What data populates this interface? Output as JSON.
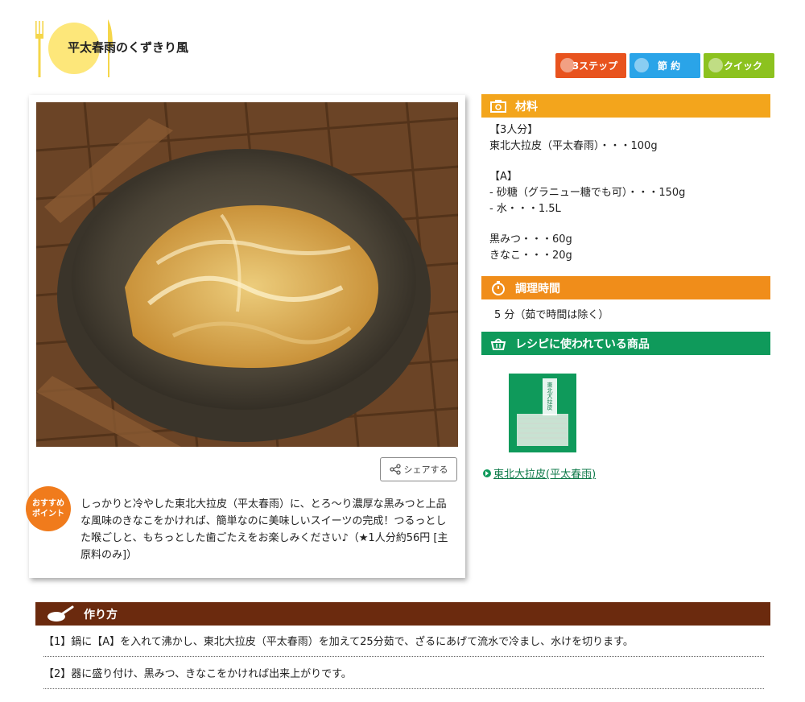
{
  "title": "平太春雨のくずきり風",
  "badges": {
    "step": "3ステップ",
    "save": "節 約",
    "quick": "クイック"
  },
  "share": {
    "label": "シェアする"
  },
  "point": {
    "badge_line1": "おすすめ",
    "badge_line2": "ポイント",
    "text": "しっかりと冷やした東北大拉皮（平太春雨）に、とろ〜り濃厚な黒みつと上品な風味のきなこをかければ、簡単なのに美味しいスイーツの完成！つるっとした喉ごしと、もちっとした歯ごたえをお楽しみください♪（★1人分約56円 [主原料のみ]）"
  },
  "ingredients": {
    "heading": "材料",
    "lines": [
      "【3人分】",
      "東北大拉皮（平太春雨）・・・100g",
      "",
      "【A】",
      "- 砂糖（グラニュー糖でも可）・・・150g",
      "- 水・・・1.5L",
      "",
      "黒みつ・・・60g",
      "きなこ・・・20g"
    ]
  },
  "cook_time": {
    "heading": "調理時間",
    "text": "5 分（茹で時間は除く）"
  },
  "products": {
    "heading": "レシピに使われている商品",
    "link": "東北大拉皮(平太春雨)",
    "package_text": "東北大拉皮"
  },
  "method": {
    "heading": "作り方",
    "steps": [
      "【1】鍋に【A】を入れて沸かし、東北大拉皮（平太春雨）を加えて25分茹で、ざるにあげて流水で冷まし、水けを切ります。",
      "【2】器に盛り付け、黒みつ、きなこをかければ出来上がりです。"
    ]
  },
  "colors": {
    "ingredients": "#f3a51c",
    "cook_time": "#f08d1a",
    "products": "#0f9a5b",
    "method": "#6b2a0e",
    "step_badge": "#e8531e",
    "save_badge": "#2aa4e8",
    "quick_badge": "#8cc21f"
  }
}
